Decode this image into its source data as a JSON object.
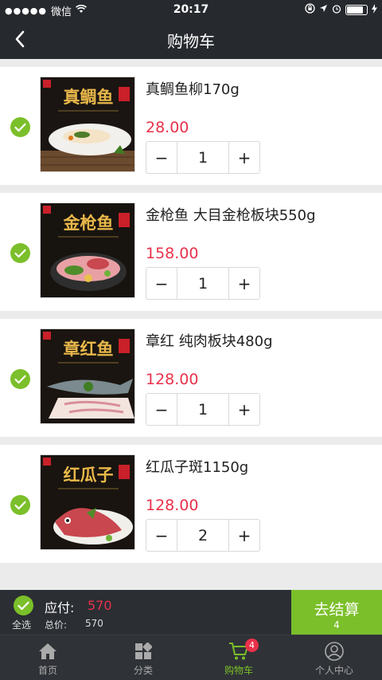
{
  "status_bar": {
    "carrier": "微信",
    "time": "20:17",
    "signal_dots": "●●●●●"
  },
  "header": {
    "title": "购物车"
  },
  "colors": {
    "accent_green": "#7bbf2a",
    "price_red": "#e8314a",
    "dark_bar": "#26292e"
  },
  "cart": {
    "items": [
      {
        "image_title": "真鲷鱼",
        "name": "真鲷鱼柳170g",
        "price": "28.00",
        "qty": "1",
        "minus": "−",
        "plus": "+"
      },
      {
        "image_title": "金枪鱼",
        "name": "金枪鱼 大目金枪板块550g",
        "price": "158.00",
        "qty": "1",
        "minus": "−",
        "plus": "+"
      },
      {
        "image_title": "章红鱼",
        "name": "章红 纯肉板块480g",
        "price": "128.00",
        "qty": "1",
        "minus": "−",
        "plus": "+"
      },
      {
        "image_title": "红瓜子",
        "name": "红瓜子斑1150g",
        "price": "128.00",
        "qty": "2",
        "minus": "−",
        "plus": "+"
      }
    ]
  },
  "checkout": {
    "select_all_label": "全选",
    "payable_label": "应付:",
    "payable_value": "570",
    "total_label": "总价:",
    "total_value": "570",
    "checkout_label": "去结算",
    "checkout_count": "4"
  },
  "tabbar": {
    "tabs": [
      {
        "label": "首页",
        "icon": "home-icon"
      },
      {
        "label": "分类",
        "icon": "category-icon"
      },
      {
        "label": "购物车",
        "icon": "cart-icon",
        "badge": "4",
        "active": true
      },
      {
        "label": "个人中心",
        "icon": "user-icon"
      }
    ]
  }
}
